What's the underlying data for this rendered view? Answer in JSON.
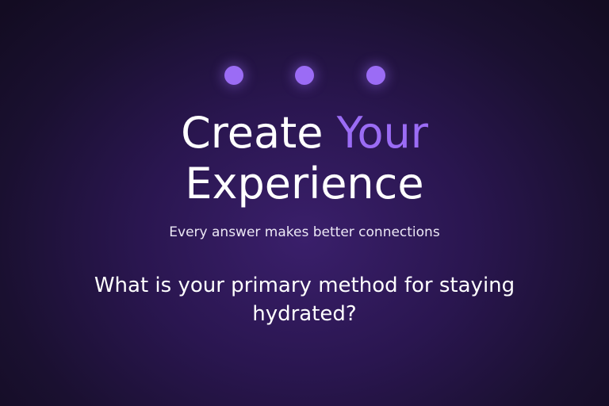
{
  "progress": {
    "steps": [
      {
        "label": "step-1",
        "state": "active"
      },
      {
        "label": "step-2",
        "state": "active"
      },
      {
        "label": "step-3",
        "state": "active"
      }
    ],
    "dot_color": "#9b6cf5"
  },
  "header": {
    "title_part1": "Create ",
    "title_part2": "Your",
    "title_part3": "Experience",
    "accent_color": "#9b6cf5",
    "subtitle": "Every answer makes better connections"
  },
  "question": {
    "text": "What is your primary method for staying hydrated?"
  },
  "colors": {
    "background": "#1a1030",
    "text": "#ffffff"
  }
}
